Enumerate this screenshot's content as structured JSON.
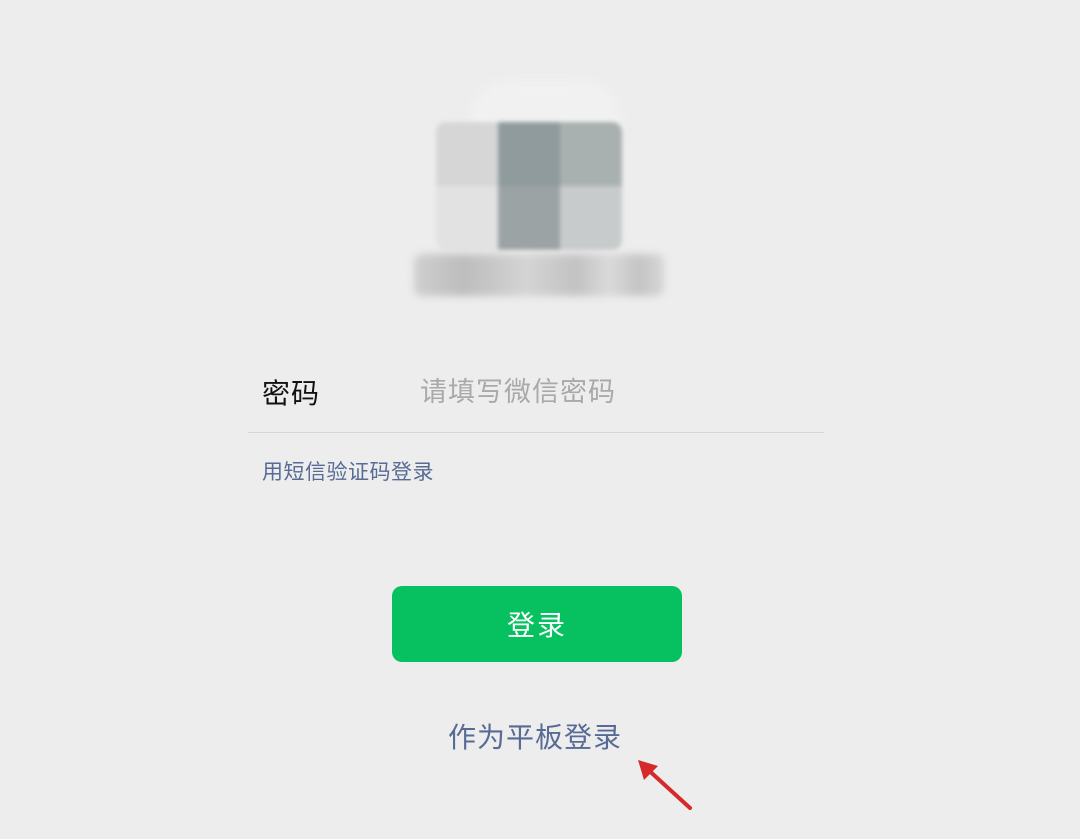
{
  "login": {
    "password_label": "密码",
    "password_placeholder": "请填写微信密码",
    "password_value": "",
    "sms_login_link": "用短信验证码登录",
    "login_button": "登录",
    "tablet_login_link": "作为平板登录"
  },
  "avatar": {
    "pixel_colors": [
      "#d6d6d6",
      "#8f9b9d",
      "#a9b0b0",
      "#e2e2e2",
      "#9ca3a4",
      "#c7cbcb"
    ]
  },
  "annotation": {
    "arrow_color": "#d42a2a",
    "arrow_icon": "red-arrow-pointer"
  },
  "colors": {
    "background": "#ededed",
    "accent_green": "#07c160",
    "link_blue": "#576b95"
  }
}
